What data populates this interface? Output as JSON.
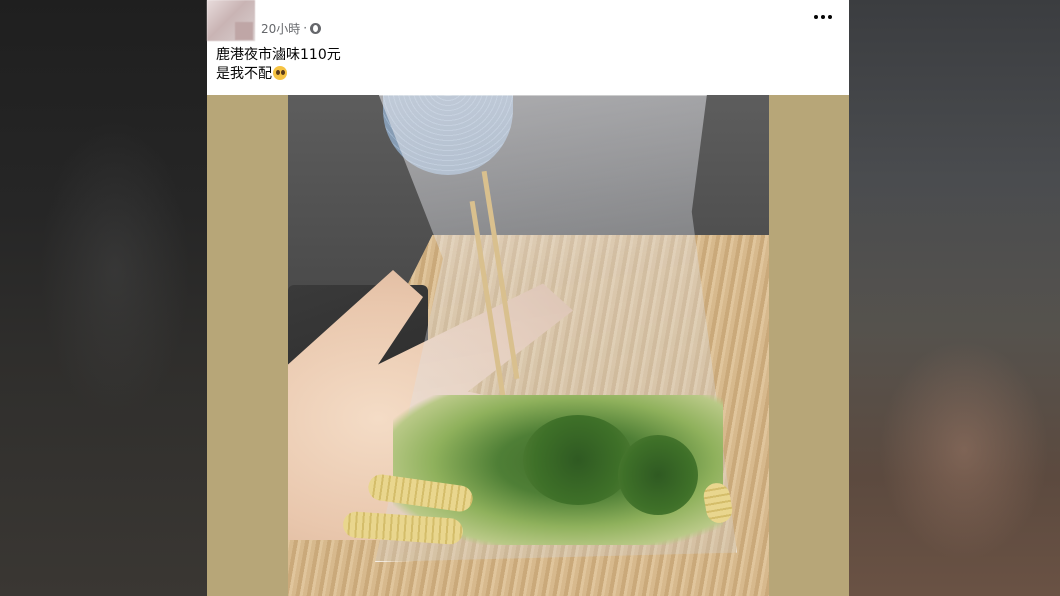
{
  "post": {
    "timestamp": "20小時",
    "separator": "·",
    "text_line1": "鹿港夜市滷味110元",
    "text_line2": "是我不配",
    "more_label": "…",
    "privacy_icon": "globe-icon",
    "emoji_icon": "worried-face-icon"
  },
  "colors": {
    "card_background": "#ffffff",
    "photo_letterbox": "#b7a678",
    "meta_text": "#65676b",
    "body_text": "#050505"
  }
}
